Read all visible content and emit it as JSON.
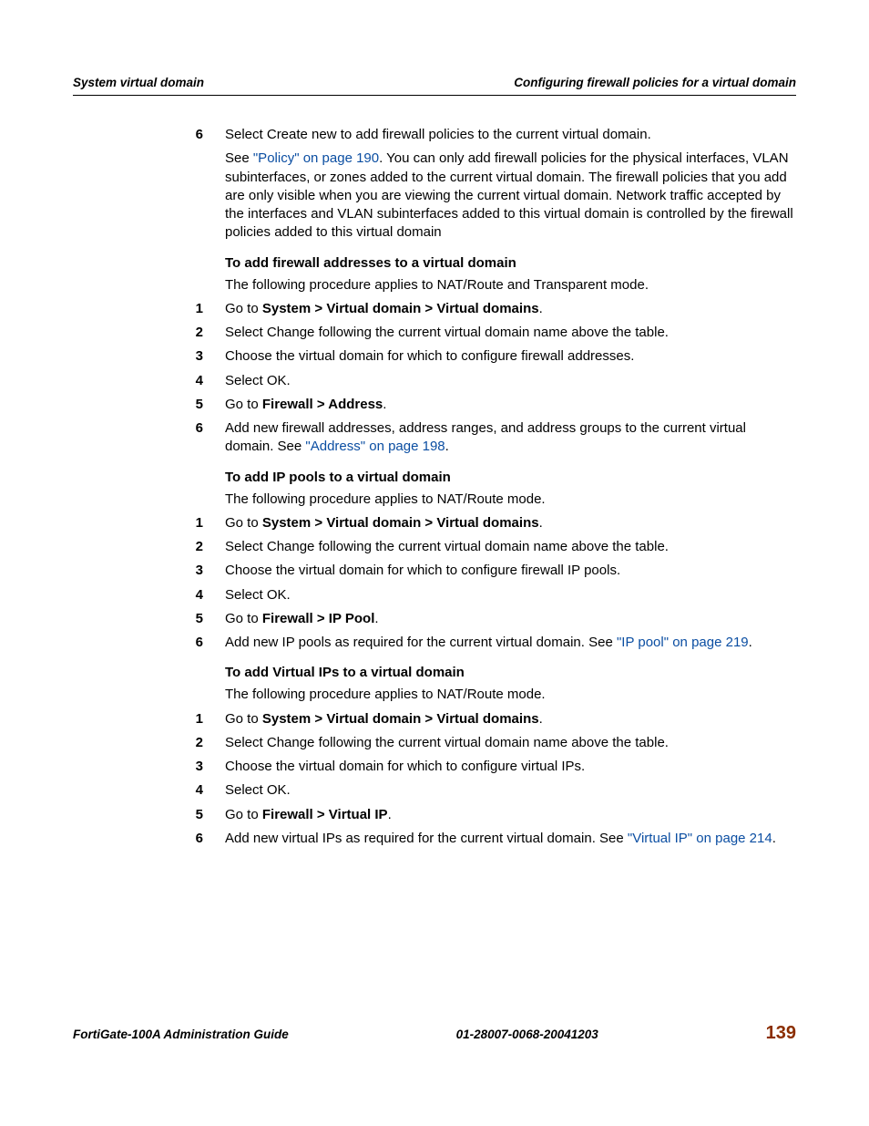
{
  "header": {
    "left": "System virtual domain",
    "right": "Configuring firewall policies for a virtual domain"
  },
  "footer": {
    "left": "FortiGate-100A Administration Guide",
    "center": "01-28007-0068-20041203",
    "page": "139"
  },
  "intro": {
    "step6_num": "6",
    "step6_line1": "Select Create new to add firewall policies to the current virtual domain.",
    "step6_line2a": "See ",
    "step6_link": "\"Policy\" on page 190",
    "step6_line2b": ". You can only add firewall policies for the physical interfaces, VLAN subinterfaces, or zones added to the current virtual domain. The firewall policies that you add are only visible when you are viewing the current virtual domain. Network traffic accepted by the interfaces and VLAN subinterfaces added to this virtual domain is controlled by the firewall policies added to this virtual domain"
  },
  "section1": {
    "title": "To add firewall addresses to a virtual domain",
    "desc": "The following procedure applies to NAT/Route and Transparent mode.",
    "steps": [
      {
        "n": "1",
        "pre": "Go to ",
        "bold": "System > Virtual domain > Virtual domains",
        "post": "."
      },
      {
        "n": "2",
        "pre": "Select Change following the current virtual domain name above the table.",
        "bold": "",
        "post": ""
      },
      {
        "n": "3",
        "pre": "Choose the virtual domain for which to configure firewall addresses.",
        "bold": "",
        "post": ""
      },
      {
        "n": "4",
        "pre": "Select OK.",
        "bold": "",
        "post": ""
      },
      {
        "n": "5",
        "pre": "Go to ",
        "bold": "Firewall > Address",
        "post": "."
      },
      {
        "n": "6",
        "pre": "Add new firewall addresses, address ranges, and address groups to the current virtual domain. See ",
        "link": "\"Address\" on page 198",
        "post": "."
      }
    ]
  },
  "section2": {
    "title": "To add IP pools to a virtual domain",
    "desc": "The following procedure applies to NAT/Route mode.",
    "steps": [
      {
        "n": "1",
        "pre": "Go to ",
        "bold": "System > Virtual domain > Virtual domains",
        "post": "."
      },
      {
        "n": "2",
        "pre": "Select Change following the current virtual domain name above the table.",
        "bold": "",
        "post": ""
      },
      {
        "n": "3",
        "pre": "Choose the virtual domain for which to configure firewall IP pools.",
        "bold": "",
        "post": ""
      },
      {
        "n": "4",
        "pre": "Select OK.",
        "bold": "",
        "post": ""
      },
      {
        "n": "5",
        "pre": "Go to ",
        "bold": "Firewall > IP Pool",
        "post": "."
      },
      {
        "n": "6",
        "pre": "Add new IP pools as required for the current virtual domain. See ",
        "link": "\"IP pool\" on page 219",
        "post": "."
      }
    ]
  },
  "section3": {
    "title": "To add Virtual IPs to a virtual domain",
    "desc": "The following procedure applies to NAT/Route mode.",
    "steps": [
      {
        "n": "1",
        "pre": "Go to ",
        "bold": "System > Virtual domain > Virtual domains",
        "post": "."
      },
      {
        "n": "2",
        "pre": "Select Change following the current virtual domain name above the table.",
        "bold": "",
        "post": ""
      },
      {
        "n": "3",
        "pre": "Choose the virtual domain for which to configure virtual IPs.",
        "bold": "",
        "post": ""
      },
      {
        "n": "4",
        "pre": "Select OK.",
        "bold": "",
        "post": ""
      },
      {
        "n": "5",
        "pre": "Go to ",
        "bold": "Firewall > Virtual IP",
        "post": "."
      },
      {
        "n": "6",
        "pre": "Add new virtual IPs as required for the current virtual domain. See ",
        "link": "\"Virtual IP\" on page 214",
        "post": "."
      }
    ]
  }
}
